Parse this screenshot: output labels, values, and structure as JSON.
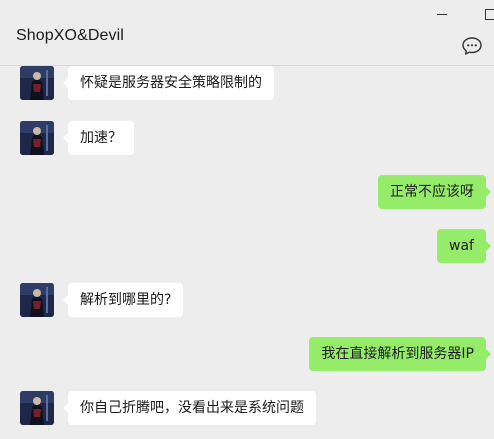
{
  "window": {
    "title": "ShopXO&Devil",
    "minimize_icon": "minimize-icon",
    "maximize_icon": "maximize-icon",
    "more_icon": "chat-more-icon"
  },
  "colors": {
    "background": "#ededed",
    "incoming_bubble": "#ffffff",
    "outgoing_bubble": "#95ec69",
    "text": "#1a1a1a"
  },
  "messages": [
    {
      "side": "left",
      "text": "怀疑是服务器安全策略限制的"
    },
    {
      "side": "left",
      "text": "加速？"
    },
    {
      "side": "right",
      "text": "正常不应该呀"
    },
    {
      "side": "right",
      "text": "waf"
    },
    {
      "side": "left",
      "text": "解析到哪里的?"
    },
    {
      "side": "right",
      "text": "我在直接解析到服务器IP"
    },
    {
      "side": "left",
      "text": "你自己折腾吧，没看出来是系统问题"
    }
  ]
}
